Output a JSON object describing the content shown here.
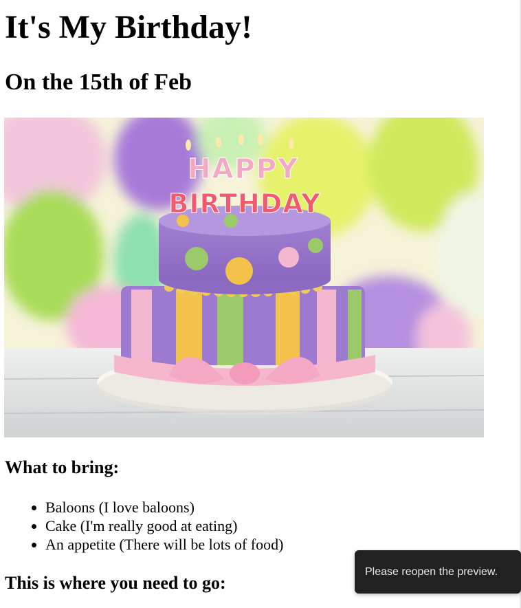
{
  "heading": "It's My Birthday!",
  "subheading": "On the 15th of Feb",
  "image": {
    "topper_line1": "HAPPY",
    "topper_line2": "BIRTHDAY"
  },
  "bring_section": {
    "title": "What to bring:",
    "items": [
      "Baloons (I love baloons)",
      "Cake (I'm really good at eating)",
      "An appetite (There will be lots of food)"
    ]
  },
  "location_section": {
    "title": "This is where you need to go:"
  },
  "toast": {
    "message": "Please reopen the preview."
  }
}
